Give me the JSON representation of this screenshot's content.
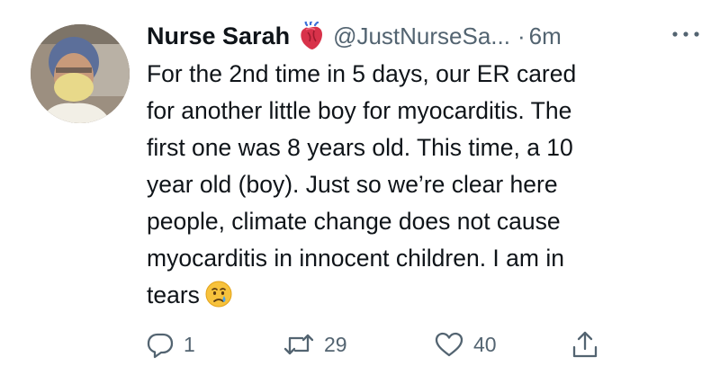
{
  "author": {
    "name": "Nurse Sarah",
    "handle": "@JustNurseSa...",
    "separator": "·",
    "time": "6m"
  },
  "tweet": {
    "lines": [
      "For the 2nd time in 5 days, our ER cared",
      "for another little boy for myocarditis. The",
      "first one was 8 years old. This time, a 10",
      "year old (boy).  Just so we’re clear here",
      "people, climate change does not cause",
      "myocarditis in innocent children.  I am in",
      "tears"
    ]
  },
  "actions": {
    "replies": "1",
    "retweets": "29",
    "likes": "40"
  },
  "icons": {
    "badge": "anatomical-heart-icon",
    "emoji": "crying-face-icon",
    "more": "more-dots-icon",
    "reply": "reply-icon",
    "retweet": "retweet-icon",
    "like": "like-icon",
    "share": "share-icon"
  },
  "colors": {
    "text": "#0f1419",
    "secondary": "#536471",
    "background": "#ffffff"
  }
}
